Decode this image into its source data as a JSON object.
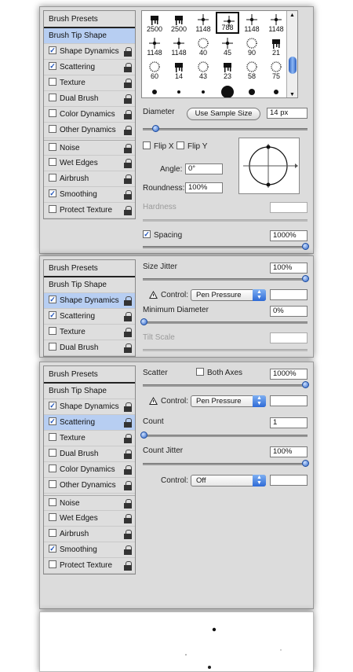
{
  "panel1": {
    "sidebar": {
      "header": "Brush Presets",
      "items": [
        {
          "label": "Brush Tip Shape",
          "checked": null,
          "selected": true
        },
        {
          "label": "Shape Dynamics",
          "checked": true
        },
        {
          "label": "Scattering",
          "checked": true
        },
        {
          "label": "Texture",
          "checked": false
        },
        {
          "label": "Dual Brush",
          "checked": false
        },
        {
          "label": "Color Dynamics",
          "checked": false
        },
        {
          "label": "Other Dynamics",
          "checked": false
        },
        {
          "label": "Noise",
          "checked": false,
          "gap": true
        },
        {
          "label": "Wet Edges",
          "checked": false
        },
        {
          "label": "Airbrush",
          "checked": false
        },
        {
          "label": "Smoothing",
          "checked": true
        },
        {
          "label": "Protect Texture",
          "checked": false
        }
      ]
    },
    "brush_sizes": [
      "2500",
      "2500",
      "1148",
      "788",
      "1148",
      "1148",
      "1148",
      "1148",
      "40",
      "45",
      "90",
      "21",
      "60",
      "14",
      "43",
      "23",
      "58",
      "75"
    ],
    "diameter_label": "Diameter",
    "use_sample_size": "Use Sample Size",
    "diameter_value": "14 px",
    "flip_x": "Flip X",
    "flip_y": "Flip Y",
    "angle_label": "Angle:",
    "angle_value": "0°",
    "roundness_label": "Roundness:",
    "roundness_value": "100%",
    "hardness_label": "Hardness",
    "spacing_label": "Spacing",
    "spacing_value": "1000%"
  },
  "panel2": {
    "sidebar": {
      "header": "Brush Presets",
      "items": [
        {
          "label": "Brush Tip Shape"
        },
        {
          "label": "Shape Dynamics",
          "checked": true,
          "selected": true
        },
        {
          "label": "Scattering",
          "checked": true
        },
        {
          "label": "Texture",
          "checked": false
        },
        {
          "label": "Dual Brush",
          "checked": false
        }
      ]
    },
    "size_jitter_label": "Size Jitter",
    "size_jitter_value": "100%",
    "control_label": "Control:",
    "control_value": "Pen Pressure",
    "min_diameter_label": "Minimum Diameter",
    "min_diameter_value": "0%",
    "tilt_scale_label": "Tilt Scale"
  },
  "panel3": {
    "sidebar": {
      "header": "Brush Presets",
      "items": [
        {
          "label": "Brush Tip Shape"
        },
        {
          "label": "Shape Dynamics",
          "checked": true
        },
        {
          "label": "Scattering",
          "checked": true,
          "selected": true
        },
        {
          "label": "Texture",
          "checked": false
        },
        {
          "label": "Dual Brush",
          "checked": false
        },
        {
          "label": "Color Dynamics",
          "checked": false
        },
        {
          "label": "Other Dynamics",
          "checked": false
        },
        {
          "label": "Noise",
          "checked": false,
          "gap": true
        },
        {
          "label": "Wet Edges",
          "checked": false
        },
        {
          "label": "Airbrush",
          "checked": false
        },
        {
          "label": "Smoothing",
          "checked": true
        },
        {
          "label": "Protect Texture",
          "checked": false
        }
      ]
    },
    "scatter_label": "Scatter",
    "both_axes": "Both Axes",
    "scatter_value": "1000%",
    "control_label": "Control:",
    "control_value": "Pen Pressure",
    "count_label": "Count",
    "count_value": "1",
    "count_jitter_label": "Count Jitter",
    "count_jitter_value": "100%",
    "control2_label": "Control:",
    "control2_value": "Off"
  },
  "colors": {
    "accent": "#2c64c8",
    "selected_row": "#b7cef2",
    "panel_bg": "#dcdcdc"
  }
}
